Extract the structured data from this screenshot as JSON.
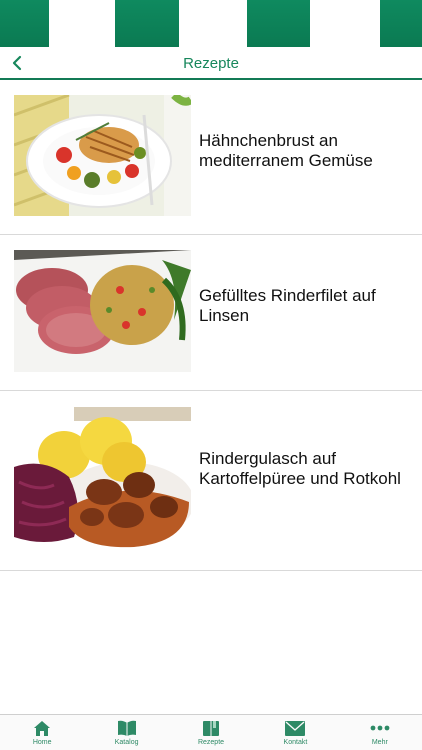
{
  "header": {
    "title": "Rezepte",
    "back_icon": "chevron-left-icon"
  },
  "colors": {
    "brand_green": "#0f8a5f",
    "title_green": "#17875c"
  },
  "recipes": [
    {
      "title": "Hähnchenbrust an mediterranem Gemüse"
    },
    {
      "title": "Gefülltes Rinderfilet auf Linsen"
    },
    {
      "title": "Rindergulasch auf Kartoffelpüree und Rotkohl"
    }
  ],
  "tabs": [
    {
      "label": "Home",
      "icon": "home-icon"
    },
    {
      "label": "Katalog",
      "icon": "book-icon"
    },
    {
      "label": "Rezepte",
      "icon": "recipe-book-icon"
    },
    {
      "label": "Kontakt",
      "icon": "mail-icon"
    },
    {
      "label": "Mehr",
      "icon": "more-icon"
    }
  ]
}
